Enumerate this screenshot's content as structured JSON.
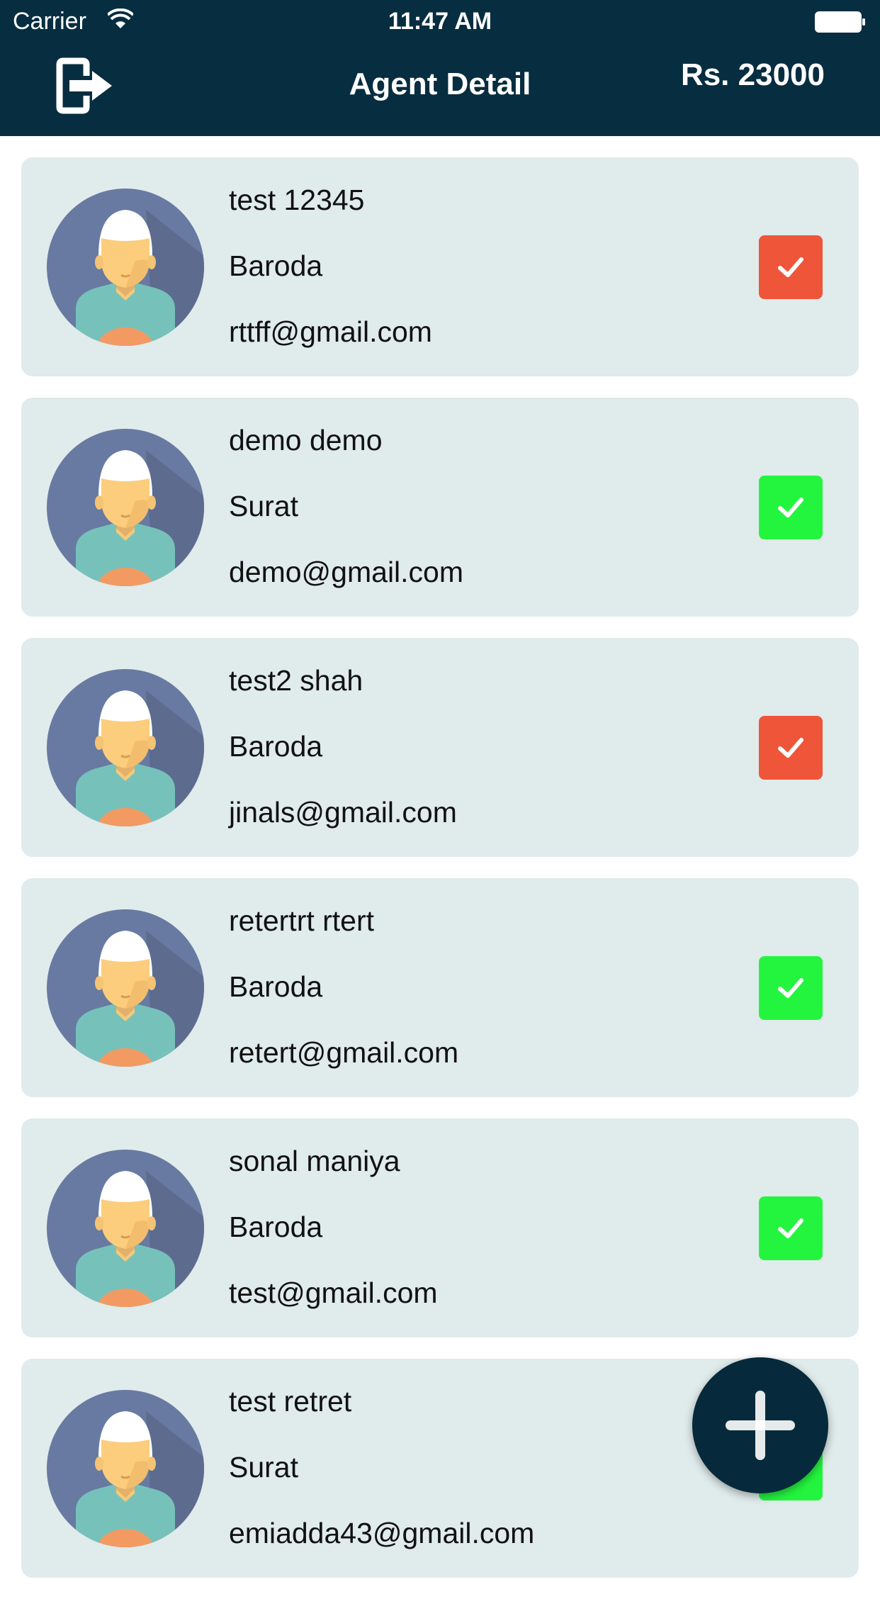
{
  "status_bar": {
    "carrier": "Carrier",
    "time": "11:47 AM"
  },
  "header": {
    "title": "Agent Detail",
    "balance": "Rs. 23000"
  },
  "agents": [
    {
      "name": "test 12345",
      "city": "Baroda",
      "email": "rttff@gmail.com",
      "status": "red"
    },
    {
      "name": "demo demo",
      "city": "Surat",
      "email": "demo@gmail.com",
      "status": "green"
    },
    {
      "name": "test2 shah",
      "city": "Baroda",
      "email": "jinals@gmail.com",
      "status": "red"
    },
    {
      "name": "retertrt rtert",
      "city": "Baroda",
      "email": "retert@gmail.com",
      "status": "green"
    },
    {
      "name": "sonal maniya",
      "city": "Baroda",
      "email": "test@gmail.com",
      "status": "green"
    },
    {
      "name": "test retret",
      "city": "Surat",
      "email": "emiadda43@gmail.com",
      "status": "green"
    }
  ],
  "colors": {
    "header_bg": "#072d40",
    "card_bg": "#e0ebeb",
    "status_red": "#ef5538",
    "status_green": "#23f53e",
    "fab_bg": "#062a3b"
  },
  "icons": {
    "logout": "logout-icon",
    "status": "checkmark-icon",
    "add": "plus-icon",
    "avatar": "user-avatar"
  }
}
